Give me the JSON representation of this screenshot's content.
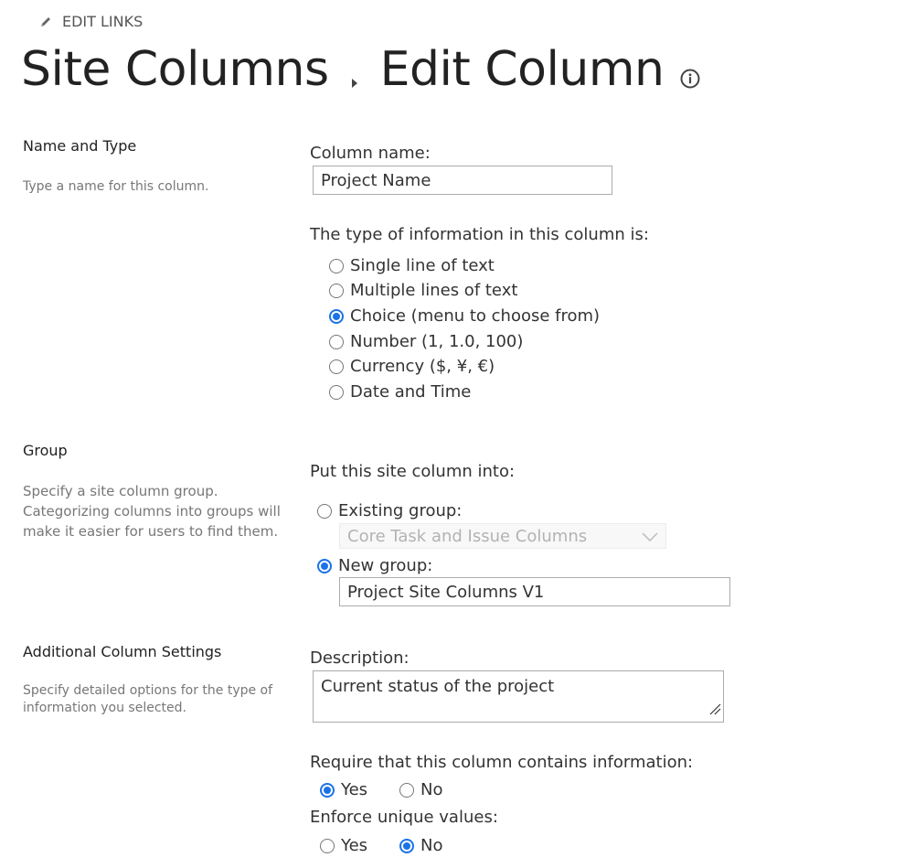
{
  "header": {
    "edit_links_label": "EDIT LINKS",
    "breadcrumb": {
      "parent": "Site Columns",
      "current": "Edit Column"
    }
  },
  "sections": {
    "name_and_type": {
      "title": "Name and Type",
      "description": "Type a name for this column.",
      "column_name_label": "Column name:",
      "column_name_value": "Project Name",
      "type_label": "The type of information in this column is:",
      "type_options": [
        {
          "label": "Single line of text",
          "checked": false
        },
        {
          "label": "Multiple lines of text",
          "checked": false
        },
        {
          "label": "Choice (menu to choose from)",
          "checked": true
        },
        {
          "label": "Number (1, 1.0, 100)",
          "checked": false
        },
        {
          "label": "Currency ($, ¥, €)",
          "checked": false
        },
        {
          "label": "Date and Time",
          "checked": false
        }
      ]
    },
    "group": {
      "title": "Group",
      "description_lines": [
        "Specify a site column group.",
        "Categorizing columns into groups will",
        "make it easier for users to find them."
      ],
      "put_into_label": "Put this site column into:",
      "existing_group_label": "Existing group:",
      "existing_group_checked": false,
      "existing_group_value": "Core Task and Issue Columns",
      "new_group_label": "New group:",
      "new_group_checked": true,
      "new_group_value": "Project Site Columns V1"
    },
    "additional": {
      "title": "Additional Column Settings",
      "description_lines": [
        "Specify detailed options for the type of",
        "information you selected."
      ],
      "description_label": "Description:",
      "description_value": "Current status of the project",
      "require_label": "Require that this column contains information:",
      "require_options": [
        {
          "label": "Yes",
          "checked": true
        },
        {
          "label": "No",
          "checked": false
        }
      ],
      "unique_label": "Enforce unique values:",
      "unique_options": [
        {
          "label": "Yes",
          "checked": false
        },
        {
          "label": "No",
          "checked": true
        }
      ]
    }
  },
  "colors": {
    "accent": "#1a73e8",
    "title_text": "#222222",
    "description_text": "#777777"
  },
  "icons": {
    "edit": "pencil-icon",
    "breadcrumb_separator": "triangle-right-icon",
    "info": "info-circle-icon",
    "dropdown": "chevron-down-icon",
    "resize": "resize-grip-icon"
  }
}
